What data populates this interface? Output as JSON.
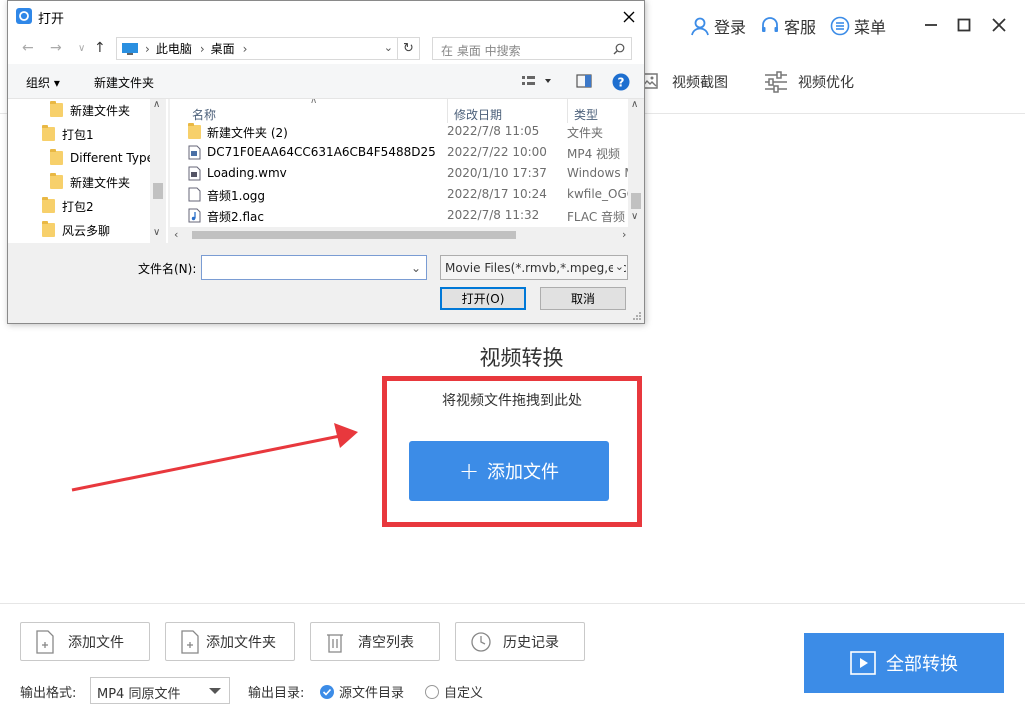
{
  "header": {
    "login_label": "登录",
    "service_label": "客服",
    "menu_label": "菜单"
  },
  "toolbar": {
    "screenshot_label": "视频截图",
    "optimize_label": "视频优化"
  },
  "main": {
    "title": "视频转换",
    "drop_hint": "将视频文件拖拽到此处",
    "add_file_label": "添加文件",
    "add_file_plus": "+"
  },
  "bottom": {
    "add_file": "添加文件",
    "add_folder": "添加文件夹",
    "clear_list": "清空列表",
    "history": "历史记录",
    "format_label": "输出格式:",
    "format_value": "MP4 同原文件",
    "outdir_label": "输出目录:",
    "source_dir": "源文件目录",
    "custom_dir": "自定义",
    "convert_all": "全部转换"
  },
  "dialog": {
    "title": "打开",
    "breadcrumb": [
      "此电脑",
      "桌面"
    ],
    "search_placeholder": "在 桌面 中搜索",
    "organize": "组织 ▾",
    "new_folder": "新建文件夹",
    "tree_items": [
      "新建文件夹",
      "打包1",
      "Different Type",
      "新建文件夹",
      "打包2",
      "风云多聊"
    ],
    "columns": {
      "name": "名称",
      "date": "修改日期",
      "type": "类型"
    },
    "files": [
      {
        "name": "新建文件夹 (2)",
        "date": "2022/7/8 11:05",
        "type": "文件夹",
        "icon": "folder-icon"
      },
      {
        "name": "DC71F0EAA64CC631A6CB4F5488D25...",
        "date": "2022/7/22 10:00",
        "type": "MP4 视频",
        "icon": "video-file-icon"
      },
      {
        "name": "Loading.wmv",
        "date": "2020/1/10 17:37",
        "type": "Windows M",
        "icon": "video-file-icon"
      },
      {
        "name": "音频1.ogg",
        "date": "2022/8/17 10:24",
        "type": "kwfile_OGG",
        "icon": "document-icon"
      },
      {
        "name": "音频2.flac",
        "date": "2022/7/8 11:32",
        "type": "FLAC 音频",
        "icon": "audio-file-icon"
      }
    ],
    "filename_label": "文件名(N):",
    "filename_value": "",
    "filter_value": "Movie Files(*.rmvb,*.mpeg,etc",
    "open_label": "打开(O)",
    "cancel_label": "取消"
  },
  "colors": {
    "accent": "#3c8ce7",
    "highlight_frame": "#e8383d",
    "arrow": "#e8383d"
  }
}
